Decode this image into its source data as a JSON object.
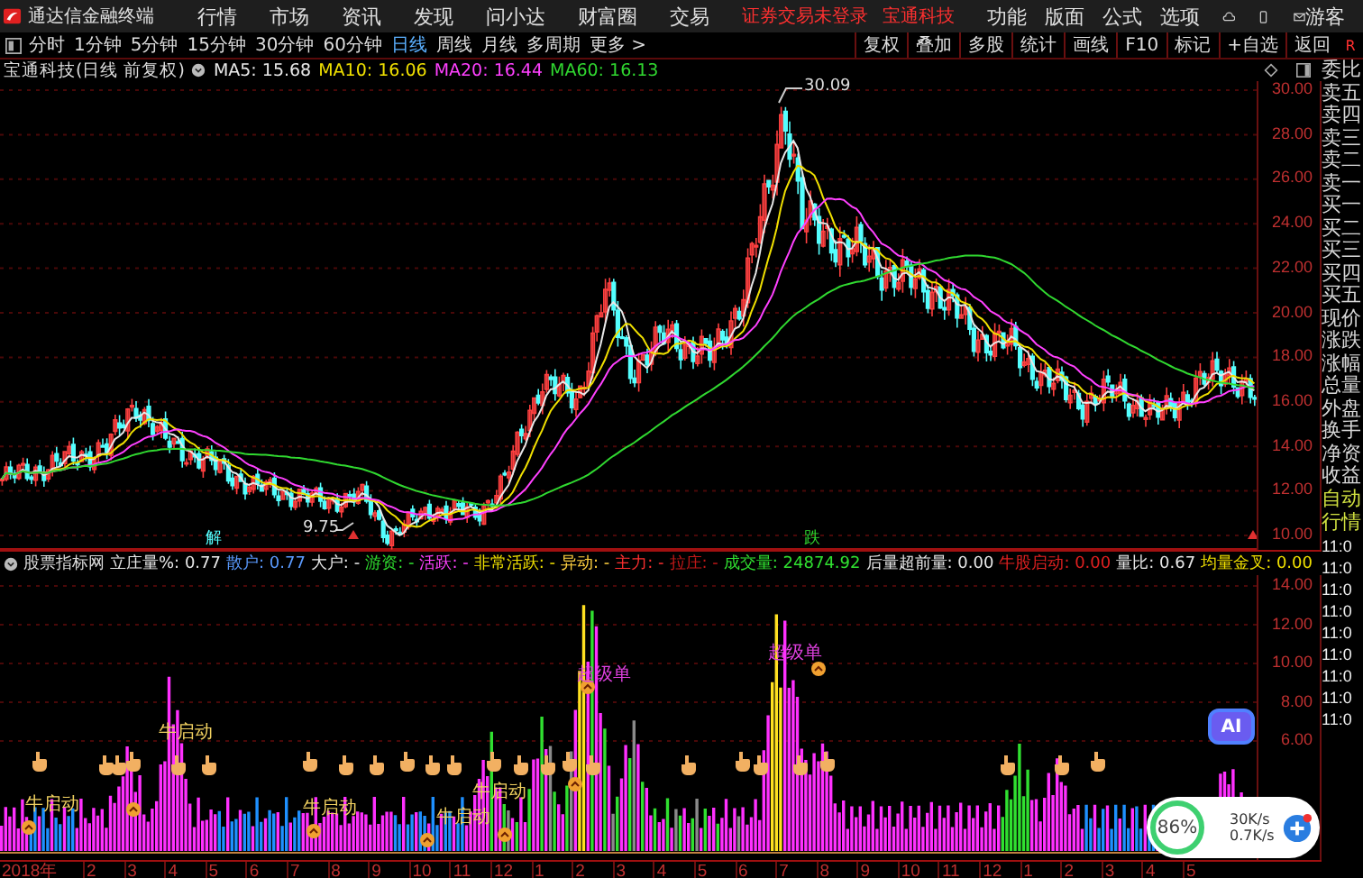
{
  "app": {
    "name": "通达信金融终端",
    "menu": [
      "行情",
      "市场",
      "资讯",
      "发现",
      "问小达",
      "财富圈",
      "交易"
    ],
    "status": [
      "证券交易未登录",
      "宝通科技"
    ],
    "right_menu": [
      "功能",
      "版面",
      "公式",
      "选项"
    ],
    "user": "游客"
  },
  "toolbar": {
    "periods": [
      {
        "label": "分时",
        "selected": false
      },
      {
        "label": "1分钟",
        "selected": false
      },
      {
        "label": "5分钟",
        "selected": false
      },
      {
        "label": "15分钟",
        "selected": false
      },
      {
        "label": "30分钟",
        "selected": false
      },
      {
        "label": "60分钟",
        "selected": false
      },
      {
        "label": "日线",
        "selected": true
      },
      {
        "label": "周线",
        "selected": false
      },
      {
        "label": "月线",
        "selected": false
      },
      {
        "label": "多周期",
        "selected": false
      },
      {
        "label": "更多 >",
        "selected": false
      }
    ],
    "buttons": [
      "复权",
      "叠加",
      "多股",
      "统计",
      "画线",
      "F10",
      "标记",
      "+自选",
      "返回"
    ],
    "corner": "R"
  },
  "price_chart": {
    "title": "宝通科技(日线 前复权)",
    "ma": [
      {
        "label": "MA5: 15.68",
        "color": "#e8e8e8"
      },
      {
        "label": "MA10: 16.06",
        "color": "#f0e000"
      },
      {
        "label": "MA20: 16.44",
        "color": "#ff40ff"
      },
      {
        "label": "MA60: 16.13",
        "color": "#30d830"
      }
    ],
    "high_label": "30.09",
    "low_label": "9.75",
    "markers": [
      {
        "label": "解",
        "color": "#54ffff"
      },
      {
        "label": "跌",
        "color": "#30d830"
      }
    ],
    "axis": [
      "30.00",
      "28.00",
      "26.00",
      "24.00",
      "22.00",
      "20.00",
      "18.00",
      "16.00",
      "14.00",
      "12.00",
      "10.00"
    ]
  },
  "indicator": {
    "title": "股票指标网",
    "items": [
      {
        "label": "立庄量%: 0.77",
        "color": "#e8e8e8"
      },
      {
        "label": "散户: 0.77",
        "color": "#5b9bff"
      },
      {
        "label": "大户: -",
        "color": "#e8e8e8"
      },
      {
        "label": "游资: -",
        "color": "#30e030"
      },
      {
        "label": "活跃: -",
        "color": "#ff40ff"
      },
      {
        "label": "非常活跃: -",
        "color": "#f0e000"
      },
      {
        "label": "异动: -",
        "color": "#ffd040"
      },
      {
        "label": "主力: -",
        "color": "#ff3030"
      },
      {
        "label": "拉庄: -",
        "color": "#c01818"
      },
      {
        "label": "成交量: 24874.92",
        "color": "#30e030"
      },
      {
        "label": "后量超前量: 0.00",
        "color": "#e8e8e8"
      },
      {
        "label": "牛股启动: 0.00",
        "color": "#e02020"
      },
      {
        "label": "量比: 0.67",
        "color": "#e8e8e8"
      },
      {
        "label": "均量金叉: 0.00",
        "color": "#f0e000"
      }
    ],
    "signals": [
      {
        "kind": "bull",
        "label": "牛启动"
      },
      {
        "kind": "bull",
        "label": "牛启动"
      },
      {
        "kind": "bull",
        "label": "牛启动"
      },
      {
        "kind": "bull",
        "label": "牛启动"
      },
      {
        "kind": "bull",
        "label": "牛启动"
      },
      {
        "kind": "super",
        "label": "超级单"
      },
      {
        "kind": "super",
        "label": "超级单"
      }
    ],
    "axis": [
      "14.00",
      "12.00",
      "10.00",
      "8.00",
      "6.00"
    ]
  },
  "dates": [
    "2018年",
    "2",
    "3",
    "4",
    "5",
    "6",
    "7",
    "8",
    "9",
    "10",
    "11",
    "12",
    "1",
    "2",
    "3",
    "4",
    "5",
    "6",
    "7",
    "8",
    "9",
    "10",
    "11",
    "12",
    "1",
    "2",
    "3",
    "4",
    "5"
  ],
  "quote_panel": {
    "labels": [
      "委比",
      "卖五",
      "卖四",
      "卖三",
      "卖二",
      "卖一",
      "买一",
      "买二",
      "买三",
      "买四",
      "买五",
      "现价",
      "涨跌",
      "涨幅",
      "总量",
      "外盘",
      "换手",
      "净资",
      "收益"
    ],
    "mode": [
      "自动",
      "行情"
    ],
    "times": [
      "11:0",
      "11:0",
      "11:0",
      "11:0",
      "11:0",
      "11:0",
      "11:0",
      "11:0",
      "11:0"
    ]
  },
  "overlay": {
    "ai": "AI",
    "percent": "86%",
    "upload": "30K/s",
    "download": "0.7K/s"
  }
}
